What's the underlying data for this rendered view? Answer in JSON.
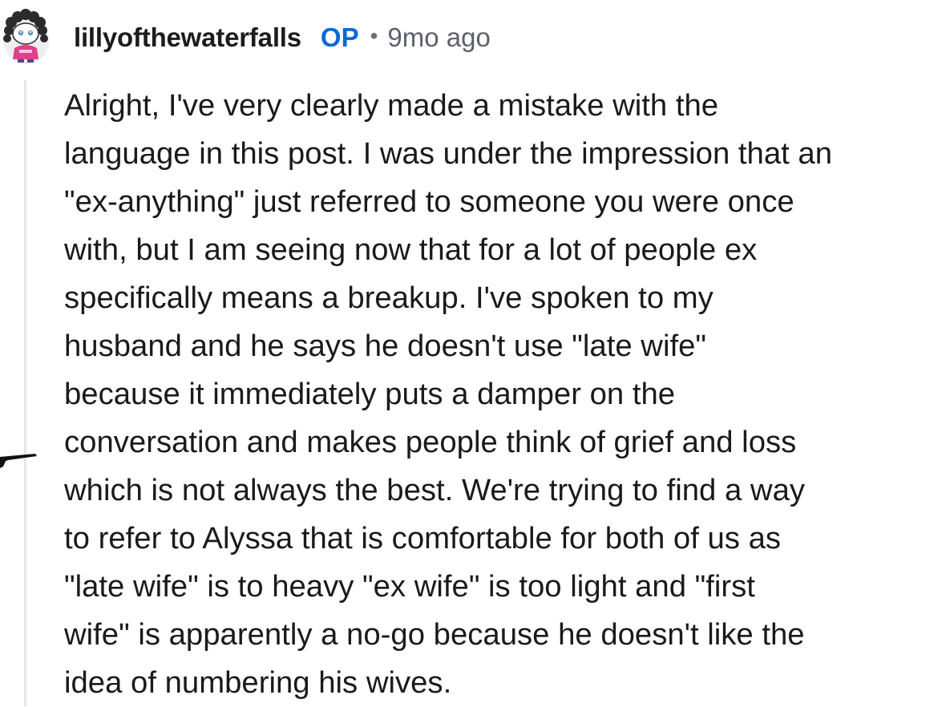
{
  "comment": {
    "author": "lillyofthewaterfalls",
    "badge": "OP",
    "separator": "•",
    "timestamp": "9mo ago",
    "avatar_icon": "snoo-avatar-icon",
    "accent_color": "#0a6ad4",
    "body_lines": [
      "Alright, I've very clearly made a mistake with the",
      "language in this post. I was under the impression that an",
      "\"ex-anything\" just referred to someone you were once",
      "with, but I am seeing now that for a lot of people ex",
      "specifically means a breakup. I've spoken to my",
      "husband and he says he doesn't use \"late wife\"",
      "because it immediately puts a damper on the",
      "conversation and makes people think of grief and loss",
      "which is not always the best. We're trying to find a way",
      "to refer to Alyssa that is comfortable for both of us as",
      "\"late wife\" is to heavy \"ex wife\" is too light and \"first",
      "wife\" is apparently a no-go because he doesn't like the",
      "idea of numbering his wives."
    ]
  }
}
